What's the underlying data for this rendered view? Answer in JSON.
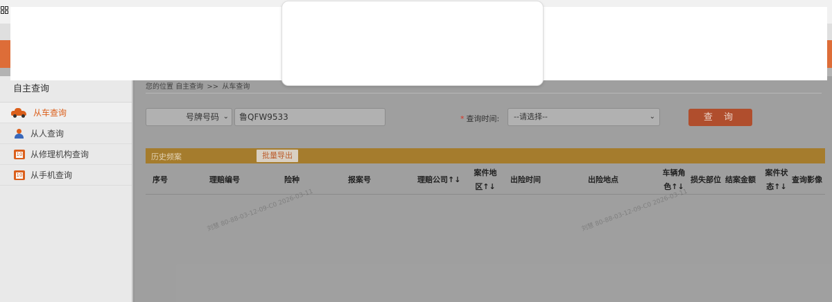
{
  "sidebar": {
    "title": "自主查询",
    "items": [
      {
        "label": "从车查询",
        "icon": "car-icon",
        "active": true
      },
      {
        "label": "从人查询",
        "icon": "person-icon",
        "active": false
      },
      {
        "label": "从修理机构查询",
        "icon": "calendar-icon",
        "active": false
      },
      {
        "label": "从手机查询",
        "icon": "calendar-icon",
        "active": false
      }
    ]
  },
  "breadcrumb": {
    "prefix": "您的位置",
    "level1": "自主查询",
    "sep": ">>",
    "level2": "从车查询"
  },
  "search": {
    "plate_type": "号牌号码",
    "plate_value": "鲁QFW9533",
    "time_label": "查询时间:",
    "time_select": "--请选择--",
    "query_button": "查 询"
  },
  "history": {
    "title": "历史频案",
    "export_button": "批量导出"
  },
  "table": {
    "headers": [
      {
        "l1": "序号"
      },
      {
        "l1": "理赔编号"
      },
      {
        "l1": "险种"
      },
      {
        "l1": "报案号"
      },
      {
        "l1": "理赔公司↑↓"
      },
      {
        "l1": "案件地",
        "l2": "区↑↓"
      },
      {
        "l1": "出险时间"
      },
      {
        "l1": "出险地点"
      },
      {
        "l1": "车辆角",
        "l2": "色↑↓"
      },
      {
        "l1": "损失部位"
      },
      {
        "l1": "结案金额"
      },
      {
        "l1": "案件状",
        "l2": "态↑↓"
      },
      {
        "l1": "查询影像"
      }
    ]
  },
  "colors": {
    "accent_orange": "#e2703a",
    "history_bar": "#a97f2e",
    "query_button": "#b4502e"
  }
}
